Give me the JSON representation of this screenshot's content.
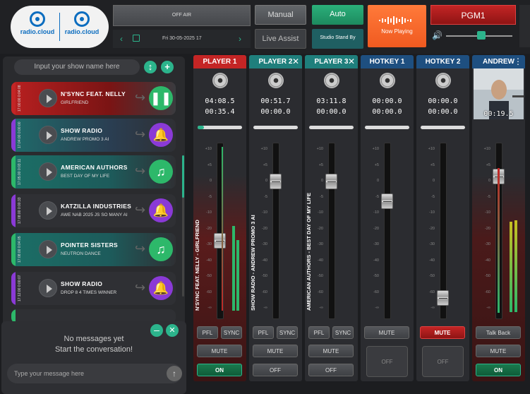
{
  "logo": {
    "left": "radio.cloud",
    "right": "radio.cloud"
  },
  "header": {
    "off_air": "OFF AIR",
    "date": "Fri 30-05-2025 17",
    "manual": "Manual",
    "live_assist": "Live Assist",
    "auto": "Auto",
    "studio_standby": "Studio Stand By",
    "now_playing": "Now Playing",
    "pgm": "PGM1",
    "volume_level": 0.5
  },
  "playlist": {
    "show_name_placeholder": "Input your show name here",
    "items": [
      {
        "title": "N'SYNC FEAT. NELLY",
        "subtitle": "GIRLFRIEND",
        "times": "17:00:00 0:04:08",
        "stripe": "#c42525",
        "action": "pause-icon"
      },
      {
        "title": "SHOW RADIO",
        "subtitle": "ANDREW PROMO 3 AI",
        "times": "17:04:00 0:00:00",
        "stripe": "#8a3ad6",
        "action": "bell-icon"
      },
      {
        "title": "AMERICAN AUTHORS",
        "subtitle": "BEST DAY OF MY LIFE",
        "times": "17:05:00 0:03:11",
        "stripe": "#2db86a",
        "action": "music-note-icon"
      },
      {
        "title": "KATZILLA INDUSTRIES",
        "subtitle": "AWE NAB 2025 JS SO MANY AI",
        "times": "17:08:00 0:00:33",
        "stripe": "#8a3ad6",
        "action": "bell-icon"
      },
      {
        "title": "POINTER SISTERS",
        "subtitle": "NEUTRON DANCE",
        "times": "17:08:00 0:04:05",
        "stripe": "#2db86a",
        "action": "music-note-icon"
      },
      {
        "title": "SHOW RADIO",
        "subtitle": "DROP 8 4 TIMES WINNER",
        "times": "17:12:00 0:00:07",
        "stripe": "#8a3ad6",
        "action": "bell-icon"
      }
    ]
  },
  "chat": {
    "empty_line1": "No messages yet",
    "empty_line2": "Start the conversation!",
    "placeholder": "Type your message here"
  },
  "channels": [
    {
      "name": "PLAYER 1",
      "color": "#c42525",
      "t1": "04:08.5",
      "t2": "00:35.4",
      "progress": 0.14,
      "vertical": "N'SYNC FEAT. NELLY - GIRLFRIEND",
      "fader": 0.55,
      "pfl": "PFL",
      "sync": "SYNC",
      "mute": "MUTE",
      "state": "ON"
    },
    {
      "name": "PLAYER 2",
      "color": "#1f7f7c",
      "t1": "00:51.7",
      "t2": "00:00.0",
      "progress": 0,
      "vertical": "SHOW RADIO - ANDREW PROMO 3 AI",
      "fader": 0.19,
      "pfl": "PFL",
      "sync": "SYNC",
      "mute": "MUTE",
      "state": "OFF"
    },
    {
      "name": "PLAYER 3",
      "color": "#1f7f7c",
      "t1": "03:11.8",
      "t2": "00:00.0",
      "progress": 0,
      "vertical": "AMERICAN AUTHORS - BEST DAY OF MY LIFE",
      "fader": 0.19,
      "pfl": "PFL",
      "sync": "SYNC",
      "mute": "MUTE",
      "state": "OFF"
    },
    {
      "name": "HOTKEY 1",
      "color": "#1e4f80",
      "t1": "00:00.0",
      "t2": "00:00.0",
      "progress": 0,
      "vertical": "",
      "fader": 0.31,
      "mute": "MUTE",
      "state": "OFF"
    },
    {
      "name": "HOTKEY 2",
      "color": "#1e4f80",
      "t1": "00:00.0",
      "t2": "00:00.0",
      "progress": 0,
      "vertical": "",
      "fader": 0.9,
      "mute": "MUTE",
      "state": "OFF"
    },
    {
      "name": "ANDREW",
      "color": "#1e4f80",
      "t1": "00:19.5",
      "t2": "",
      "progress": 0,
      "vertical": "",
      "fader": 0.16,
      "talkback": "Talk Back",
      "mute": "MUTE",
      "state": "ON"
    }
  ],
  "scale": [
    "+10",
    "+5",
    "0",
    "-5",
    "-10",
    "-20",
    "-30",
    "-40",
    "-50",
    "-60",
    "-∞"
  ]
}
